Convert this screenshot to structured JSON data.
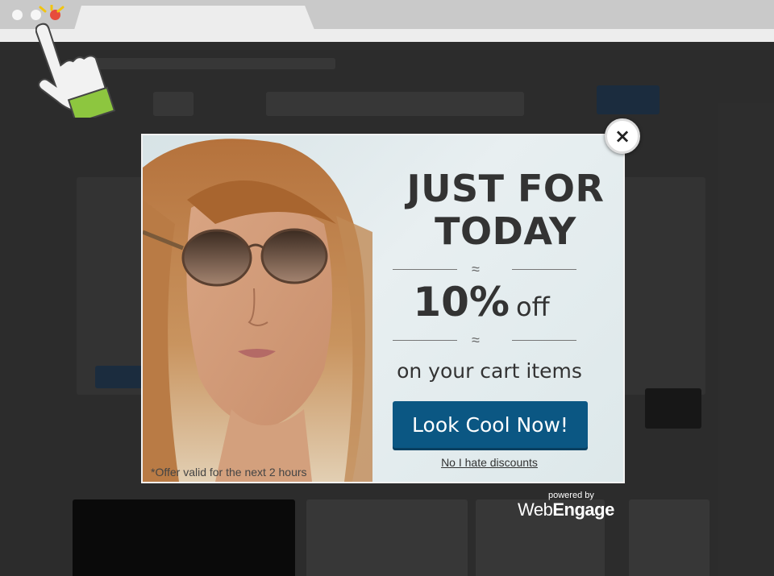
{
  "browser": {
    "window_controls": [
      "close",
      "minimize",
      "maximize"
    ],
    "cursor_icon": "hand-pointer-icon"
  },
  "popup": {
    "headline_line1": "JUST FOR",
    "headline_line2": "TODAY",
    "discount_value": "10%",
    "discount_suffix": "off",
    "subtext": "on your cart items",
    "cta_label": "Look Cool Now!",
    "decline_link": "No I hate discounts",
    "offer_note": "*Offer valid for the next 2 hours",
    "close_label": "×",
    "colors": {
      "cta": "#0b5783",
      "text": "#333333"
    }
  },
  "branding": {
    "powered_by": "powered by",
    "brand_prefix": "Web",
    "brand_suffix": "Engage"
  }
}
